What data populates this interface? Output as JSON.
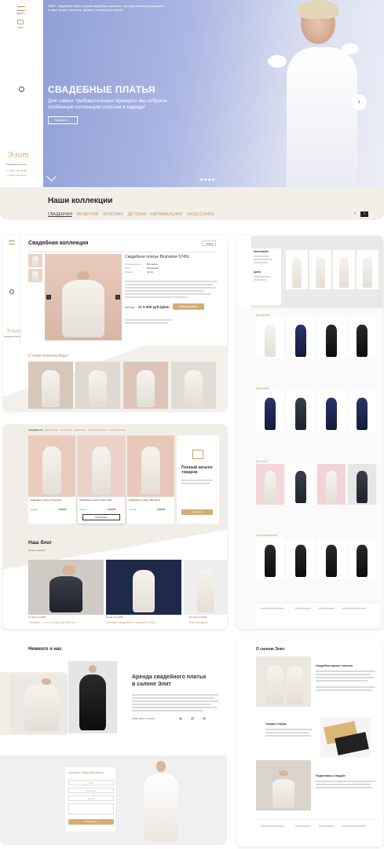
{
  "hero": {
    "menu_label": "МЕНЮ",
    "lang": "ENG",
    "intro": "ЭЛИТ - свадебный салон и прокат свадебных, вечерних, бальных платьев для девушек, а также прокат смокингов, фраков, костюмов для мужчин",
    "title": "СВАДЕБНЫЕ ПЛАТЬЯ",
    "subtitle_1": "Для самых требовательных принцесс мы собрали",
    "subtitle_2": "особенную коллекцию платьев в наряде!",
    "show_button": "Показать →",
    "logo": "Элит",
    "salon_label": "Свадебный салон",
    "phone_1": "+7 (812) 274-56-38",
    "phone_2": "+7 (812) 232-50-67",
    "collections_title": "Наши коллекции",
    "tabs": [
      "СВАДЕБНАЯ",
      "ВЕЧЕРНЯЯ",
      "МУЖСКАЯ",
      "ДЕТСКАЯ",
      "КАРНАВАЛЬНАЯ",
      "АКСЕССУАРЫ"
    ]
  },
  "product": {
    "title": "Свадебная коллекция",
    "back": "< Назад",
    "name": "Свадебное платье Blumarine 5745с",
    "specs": [
      {
        "k": "Производитель",
        "v": "Blumarine"
      },
      {
        "k": "Цвет",
        "v": "Молочный"
      },
      {
        "k": "Размер",
        "v": "42-44"
      }
    ],
    "rent_label": "Аренда",
    "price": "от 5 000 руб./день",
    "book_btn": "Забронировать",
    "also_title": "С этим платьем берут",
    "logo": "Элит",
    "salon_label": "Свадебный салон"
  },
  "catalog": {
    "filters": [
      "Коллекция",
      "Цена"
    ],
    "sections": [
      "Вечерние",
      "Мужские",
      "Детские",
      "Карнавальные"
    ]
  },
  "listing": {
    "tabs": [
      "СВАДЕБНАЯ",
      "ВЕЧЕРНЯЯ",
      "МУЖСКАЯ",
      "ДЕТСКАЯ",
      "КАРНАВАЛЬНАЯ",
      "АКСЕССУАРЫ"
    ],
    "items": [
      {
        "name": "Свадебное платье Pronovias",
        "price": "4 000 ₽"
      },
      {
        "name": "Свадебное платье Rosa Clara",
        "price": "3 000 ₽"
      },
      {
        "name": "Свадебное платье Blumarine",
        "price": "5 000 ₽"
      }
    ],
    "rent_label": "Аренда",
    "more_btn": "Подробнее",
    "catalog_title": "Полный каталог товаров",
    "catalog_btn": "Смотреть",
    "blog_title": "Наш блог",
    "blog_sort": "Новые статьи ▾",
    "posts": [
      {
        "date": "21 августа 2018",
        "title": "Смокинг + что к нему требуется"
      },
      {
        "date": "21 августа 2018",
        "title": "Тренды свадебных нарядов 2018"
      },
      {
        "date": "21 августа 2018",
        "title": "Как выбрать..."
      }
    ]
  },
  "about": {
    "title": "Немного о нас",
    "heading_1": "Аренда свадебного платья",
    "heading_2": "в салоне Элит",
    "more_link": "Подробнее о салоне",
    "form_title": "Закажите обратный звонок",
    "form_fields": [
      "Имя",
      "Телефон",
      "E-mail"
    ],
    "form_btn": "Отправить"
  },
  "salon": {
    "title": "О салоне Элит",
    "sections": [
      "Свадебное прокат платьев",
      "Скидки и акции",
      "Подготовка к свадьбе"
    ]
  }
}
